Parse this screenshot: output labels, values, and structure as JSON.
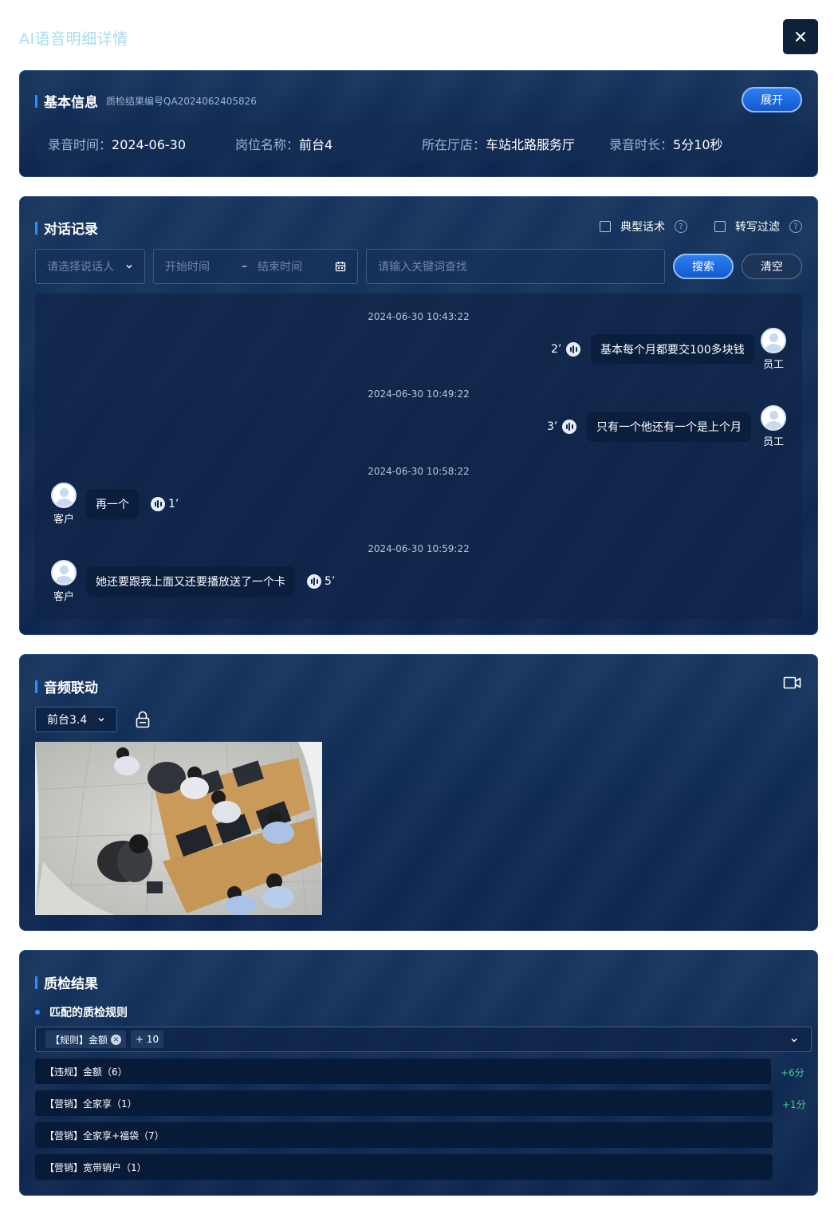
{
  "page": {
    "title": "AI语音明细详情"
  },
  "basic": {
    "title": "基本信息",
    "subtitle": "质检结果编号QA2024062405826",
    "expand_label": "展开",
    "fields": [
      {
        "label": "录音时间：",
        "value": "2024-06-30"
      },
      {
        "label": "岗位名称：",
        "value": "前台4"
      },
      {
        "label": "所在厅店：",
        "value": "车站北路服务厅"
      },
      {
        "label": "录音时长：",
        "value": "5分10秒"
      }
    ]
  },
  "dialog": {
    "title": "对话记录",
    "filters": {
      "typical": "典型话术",
      "transcribe": "转写过滤"
    },
    "speaker_placeholder": "请选择说话人",
    "start_placeholder": "开始时间",
    "range_sep": "–",
    "end_placeholder": "结束时间",
    "keyword_placeholder": "请输入关键词查找",
    "search_label": "搜索",
    "clear_label": "清空",
    "messages": [
      {
        "time": "2024-06-30 10:43:22",
        "side": "right",
        "role": "员工",
        "text": "基本每个月都要交100多块钱",
        "duration": "2’"
      },
      {
        "time": "2024-06-30 10:49:22",
        "side": "right",
        "role": "员工",
        "text": "只有一个他还有一个是上个月",
        "duration": "3’"
      },
      {
        "time": "2024-06-30 10:58:22",
        "side": "left",
        "role": "客户",
        "text": "再一个",
        "duration": "1’"
      },
      {
        "time": "2024-06-30 10:59:22",
        "side": "left",
        "role": "客户",
        "text": "她还要跟我上面又还要播放送了一个卡",
        "duration": "5’"
      }
    ]
  },
  "audio": {
    "title": "音频联动",
    "station": "前台3.4",
    "icons": {
      "video": "video-camera-icon",
      "lock": "lock-icon"
    }
  },
  "quality": {
    "title": "质检结果",
    "matched_label": "匹配的质检规则",
    "selected_tag": "【规则】金额",
    "more_count": "+ 10",
    "rules": [
      {
        "text": "【违规】金额（6）",
        "score": "+6分"
      },
      {
        "text": "【营销】全家享（1）",
        "score": "+1分"
      },
      {
        "text": "【营销】全家享+福袋（7）",
        "score": ""
      },
      {
        "text": "【营销】宽带销户（1）",
        "score": ""
      }
    ]
  },
  "colors": {
    "accent": "#2e8cff",
    "panel": "#0f2a52",
    "score": "#3fcf8e",
    "title": "#a6dcec"
  }
}
